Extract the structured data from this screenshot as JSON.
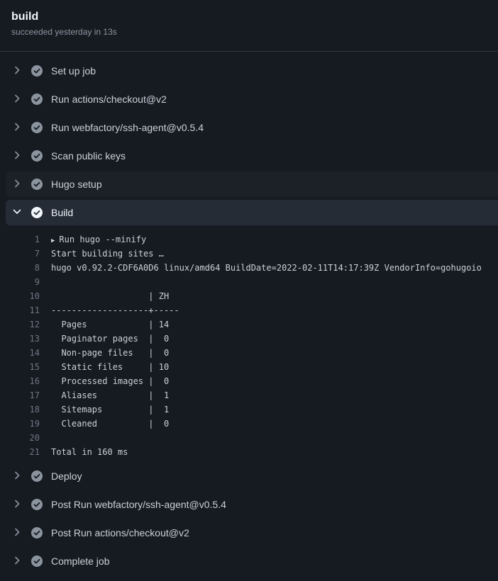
{
  "job": {
    "title": "build",
    "status": "succeeded yesterday in 13s"
  },
  "steps_before": [
    {
      "label": "Set up job",
      "status": "success"
    },
    {
      "label": "Run actions/checkout@v2",
      "status": "success"
    },
    {
      "label": "Run webfactory/ssh-agent@v0.5.4",
      "status": "success"
    },
    {
      "label": "Scan public keys",
      "status": "success"
    },
    {
      "label": "Hugo setup",
      "status": "success"
    }
  ],
  "expanded_step": {
    "label": "Build",
    "status": "success",
    "log": [
      {
        "n": "1",
        "text": "Run hugo --minify",
        "collapsible": true
      },
      {
        "n": "7",
        "text": "Start building sites …"
      },
      {
        "n": "8",
        "text": "hugo v0.92.2-CDF6A0D6 linux/amd64 BuildDate=2022-02-11T14:17:39Z VendorInfo=gohugoio"
      },
      {
        "n": "9",
        "text": ""
      },
      {
        "n": "10",
        "text": "                   | ZH"
      },
      {
        "n": "11",
        "text": "-------------------+-----"
      },
      {
        "n": "12",
        "text": "  Pages            | 14"
      },
      {
        "n": "13",
        "text": "  Paginator pages  |  0"
      },
      {
        "n": "14",
        "text": "  Non-page files   |  0"
      },
      {
        "n": "15",
        "text": "  Static files     | 10"
      },
      {
        "n": "16",
        "text": "  Processed images |  0"
      },
      {
        "n": "17",
        "text": "  Aliases          |  1"
      },
      {
        "n": "18",
        "text": "  Sitemaps         |  1"
      },
      {
        "n": "19",
        "text": "  Cleaned          |  0"
      },
      {
        "n": "20",
        "text": ""
      },
      {
        "n": "21",
        "text": "Total in 160 ms"
      }
    ]
  },
  "steps_after": [
    {
      "label": "Deploy",
      "status": "success"
    },
    {
      "label": "Post Run webfactory/ssh-agent@v0.5.4",
      "status": "success"
    },
    {
      "label": "Post Run actions/checkout@v2",
      "status": "success"
    },
    {
      "label": "Complete job",
      "status": "success"
    }
  ],
  "colors": {
    "background": "#161b22",
    "expanded_row": "#262c36",
    "hover_row": "#1c2128",
    "success_icon": "#8b949e",
    "text": "#c9d1d9"
  },
  "icons": {
    "collapsed": "chevron-right-icon",
    "expanded": "chevron-down-icon",
    "status": "check-circle-icon",
    "log_group": "triangle-right-icon"
  }
}
